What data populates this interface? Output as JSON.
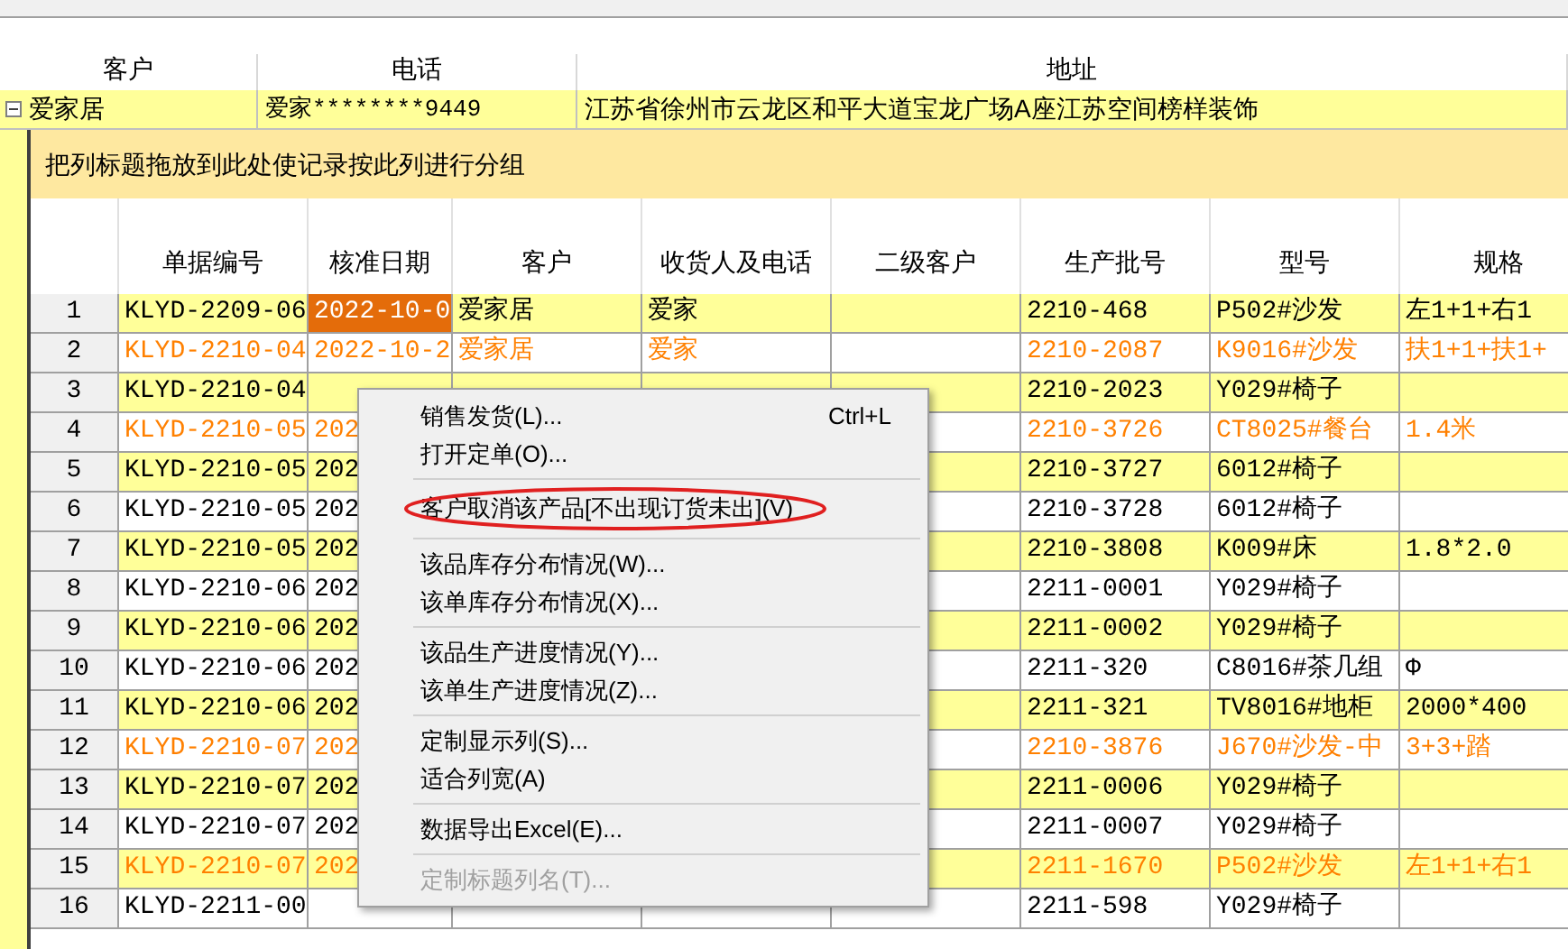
{
  "master": {
    "columns": [
      "客户",
      "电话",
      "地址"
    ],
    "row": {
      "expanded": true,
      "cells": [
        "爱家居",
        "爱家********9449",
        "江苏省徐州市云龙区和平大道宝龙广场A座江苏空间榜样装饰"
      ]
    }
  },
  "group_panel": {
    "hint": "把列标题拖放到此处使记录按此列进行分组"
  },
  "table": {
    "columns": [
      "单据编号",
      "核准日期",
      "客户",
      "收货人及电话",
      "二级客户",
      "生产批号",
      "型号",
      "规格"
    ],
    "rows": [
      {
        "no": "1",
        "flagged": false,
        "selected": true,
        "cells": [
          "KLYD-2209-06",
          "2022-10-0",
          "爱家居",
          "爱家",
          null,
          "2210-468",
          "P502#沙发",
          "左1+1+右1"
        ]
      },
      {
        "no": "2",
        "flagged": true,
        "selected": false,
        "cells": [
          "KLYD-2210-04",
          "2022-10-2",
          "爱家居",
          "爱家",
          null,
          "2210-2087",
          "K9016#沙发",
          "扶1+1+扶1+"
        ]
      },
      {
        "no": "3",
        "flagged": false,
        "selected": false,
        "cells": [
          "KLYD-2210-04",
          null,
          null,
          null,
          null,
          "2210-2023",
          "Y029#椅子",
          null
        ]
      },
      {
        "no": "4",
        "flagged": true,
        "selected": false,
        "cells": [
          "KLYD-2210-05",
          "202",
          null,
          null,
          null,
          "2210-3726",
          "CT8025#餐台",
          "1.4米"
        ]
      },
      {
        "no": "5",
        "flagged": false,
        "selected": false,
        "cells": [
          "KLYD-2210-05",
          "202",
          null,
          null,
          null,
          "2210-3727",
          "6012#椅子",
          null
        ]
      },
      {
        "no": "6",
        "flagged": false,
        "selected": false,
        "cells": [
          "KLYD-2210-05",
          "202",
          null,
          null,
          null,
          "2210-3728",
          "6012#椅子",
          null
        ]
      },
      {
        "no": "7",
        "flagged": false,
        "selected": false,
        "cells": [
          "KLYD-2210-05",
          "202",
          null,
          null,
          null,
          "2210-3808",
          "K009#床",
          "1.8*2.0"
        ]
      },
      {
        "no": "8",
        "flagged": false,
        "selected": false,
        "cells": [
          "KLYD-2210-06",
          "202",
          null,
          null,
          null,
          "2211-0001",
          "Y029#椅子",
          null
        ]
      },
      {
        "no": "9",
        "flagged": false,
        "selected": false,
        "cells": [
          "KLYD-2210-06",
          "202",
          null,
          null,
          null,
          "2211-0002",
          "Y029#椅子",
          null
        ]
      },
      {
        "no": "10",
        "flagged": false,
        "selected": false,
        "cells": [
          "KLYD-2210-06",
          "202",
          null,
          null,
          null,
          "2211-320",
          "C8016#茶几组",
          "Φ"
        ]
      },
      {
        "no": "11",
        "flagged": false,
        "selected": false,
        "cells": [
          "KLYD-2210-06",
          "202",
          null,
          null,
          null,
          "2211-321",
          "TV8016#地柜",
          "2000*400"
        ]
      },
      {
        "no": "12",
        "flagged": true,
        "selected": false,
        "cells": [
          "KLYD-2210-07",
          "202",
          null,
          null,
          null,
          "2210-3876",
          "J670#沙发-中",
          "3+3+踏"
        ]
      },
      {
        "no": "13",
        "flagged": false,
        "selected": false,
        "cells": [
          "KLYD-2210-07",
          "202",
          null,
          null,
          null,
          "2211-0006",
          "Y029#椅子",
          null
        ]
      },
      {
        "no": "14",
        "flagged": false,
        "selected": false,
        "cells": [
          "KLYD-2210-07",
          "202",
          null,
          null,
          null,
          "2211-0007",
          "Y029#椅子",
          null
        ]
      },
      {
        "no": "15",
        "flagged": true,
        "selected": false,
        "cells": [
          "KLYD-2210-07",
          "202",
          null,
          null,
          null,
          "2211-1670",
          "P502#沙发",
          "左1+1+右1"
        ]
      },
      {
        "no": "16",
        "flagged": false,
        "selected": false,
        "cells": [
          "KLYD-2211-00",
          null,
          null,
          null,
          null,
          "2211-598",
          "Y029#椅子",
          null
        ]
      }
    ]
  },
  "context_menu": {
    "items": [
      {
        "kind": "item",
        "label": "销售发货(L)...",
        "shortcut": "Ctrl+L",
        "disabled": false,
        "circled": false
      },
      {
        "kind": "item",
        "label": "打开定单(O)...",
        "disabled": false,
        "circled": false
      },
      {
        "kind": "separator"
      },
      {
        "kind": "item",
        "label": "客户取消该产品[不出现订货未出](V)",
        "disabled": false,
        "circled": true
      },
      {
        "kind": "separator"
      },
      {
        "kind": "item",
        "label": "该品库存分布情况(W)...",
        "disabled": false,
        "circled": false
      },
      {
        "kind": "item",
        "label": "该单库存分布情况(X)...",
        "disabled": false,
        "circled": false
      },
      {
        "kind": "separator"
      },
      {
        "kind": "item",
        "label": "该品生产进度情况(Y)...",
        "disabled": false,
        "circled": false
      },
      {
        "kind": "item",
        "label": "该单生产进度情况(Z)...",
        "disabled": false,
        "circled": false
      },
      {
        "kind": "separator"
      },
      {
        "kind": "item",
        "label": "定制显示列(S)...",
        "disabled": false,
        "circled": false
      },
      {
        "kind": "item",
        "label": "适合列宽(A)",
        "disabled": false,
        "circled": false
      },
      {
        "kind": "separator"
      },
      {
        "kind": "item",
        "label": "数据导出Excel(E)...",
        "disabled": false,
        "circled": false
      },
      {
        "kind": "separator"
      },
      {
        "kind": "item",
        "label": "定制标题列名(T)...",
        "disabled": true,
        "circled": false
      }
    ]
  }
}
